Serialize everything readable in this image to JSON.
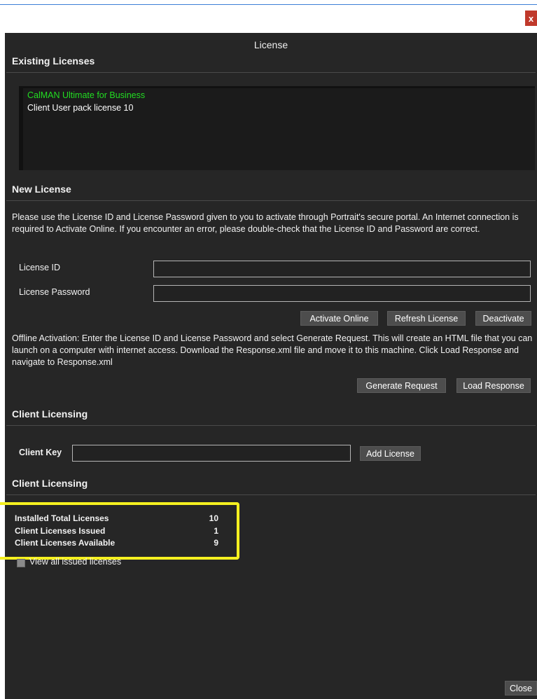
{
  "window": {
    "title": "License",
    "close_x": "x"
  },
  "existing": {
    "heading": "Existing Licenses",
    "items": [
      {
        "label": "CalMAN Ultimate for Business",
        "color": "#22dd22"
      },
      {
        "label": "Client User pack license 10",
        "color": "#ffffff"
      }
    ]
  },
  "new_license": {
    "heading": "New License",
    "description": "Please use the License ID and License Password given to you to activate through Portrait's secure portal.  An Internet connection is required to Activate Online.  If you encounter an error, please double-check that the License ID and Password are correct.",
    "license_id_label": "License ID",
    "license_id_value": "",
    "license_password_label": "License Password",
    "license_password_value": "",
    "activate_online": "Activate Online",
    "refresh_license": "Refresh License",
    "deactivate": "Deactivate",
    "offline_text": "Offline Activation:  Enter the License ID and License Password and select Generate Request.  This will create an HTML file that you can launch on a computer with internet access.  Download the Response.xml file and move it to this machine.  Click Load Response and navigate to Response.xml",
    "generate_request": "Generate Request",
    "load_response": "Load Response"
  },
  "client_licensing": {
    "heading": "Client Licensing",
    "client_key_label": "Client Key",
    "client_key_value": "",
    "add_license": "Add License"
  },
  "client_stats": {
    "heading": "Client Licensing",
    "rows": [
      {
        "label": "Installed Total Licenses",
        "value": "10"
      },
      {
        "label": "Client Licenses Issued",
        "value": "1"
      },
      {
        "label": "Client Licenses Available",
        "value": "9"
      }
    ],
    "view_all_label": "View all issued licenses",
    "view_all_checked": false
  },
  "footer": {
    "close": "Close"
  },
  "colors": {
    "accent_highlight": "#f5f020",
    "close_button": "#c0392b",
    "panel_bg": "#262626"
  }
}
